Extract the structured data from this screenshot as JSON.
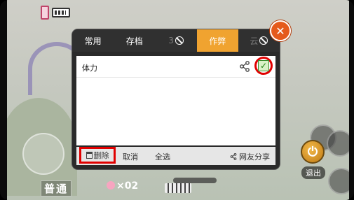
{
  "tabs": [
    {
      "label": "常用"
    },
    {
      "label": "存档"
    },
    {
      "label": "3"
    },
    {
      "label": "作弊"
    },
    {
      "label": "云"
    }
  ],
  "cheat_list": {
    "items": [
      {
        "label": "体力",
        "checked": true
      }
    ]
  },
  "toolbar": {
    "delete_label": "删除",
    "cancel_label": "取消",
    "select_all_label": "全选",
    "share_label": "网友分享"
  },
  "hud": {
    "mode_label": "普通",
    "lives_label": "×02",
    "exit_label": "退出"
  },
  "colors": {
    "accent": "#f0a330",
    "highlight": "#e10000",
    "close": "#e55a1c"
  }
}
